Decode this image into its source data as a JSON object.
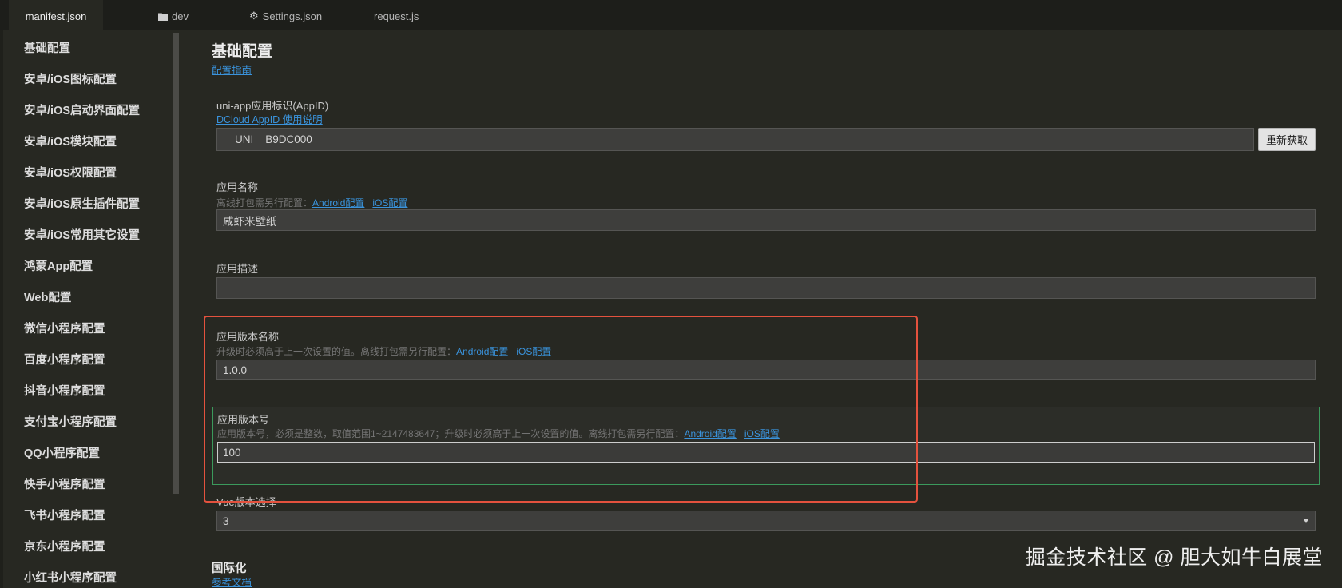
{
  "tabs": [
    {
      "label": "manifest.json"
    },
    {
      "label": "dev",
      "icon": "folder-icon"
    },
    {
      "label": "Settings.json",
      "icon": "gear-icon"
    },
    {
      "label": "request.js"
    }
  ],
  "sidebar": {
    "items": [
      "基础配置",
      "安卓/iOS图标配置",
      "安卓/iOS启动界面配置",
      "安卓/iOS模块配置",
      "安卓/iOS权限配置",
      "安卓/iOS原生插件配置",
      "安卓/iOS常用其它设置",
      "鸿蒙App配置",
      "Web配置",
      "微信小程序配置",
      "百度小程序配置",
      "抖音小程序配置",
      "支付宝小程序配置",
      "QQ小程序配置",
      "快手小程序配置",
      "飞书小程序配置",
      "京东小程序配置",
      "小红书小程序配置"
    ]
  },
  "main": {
    "title": "基础配置",
    "guide_link": "配置指南",
    "appid": {
      "label": "uni-app应用标识(AppID)",
      "help_link": "DCloud AppID 使用说明",
      "value": "__UNI__B9DC000",
      "button": "重新获取"
    },
    "app_name": {
      "label": "应用名称",
      "hint": "离线打包需另行配置：",
      "android_link": "Android配置",
      "ios_link": "iOS配置",
      "value": "咸虾米壁纸"
    },
    "app_description": {
      "label": "应用描述"
    },
    "version_name": {
      "label": "应用版本名称",
      "hint": "升级时必须高于上一次设置的值。离线打包需另行配置：",
      "android_link": "Android配置",
      "ios_link": "iOS配置",
      "value": "1.0.0"
    },
    "version_code": {
      "label": "应用版本号",
      "hint": "应用版本号，必须是整数，取值范围1~2147483647；升级时必须高于上一次设置的值。离线打包需另行配置：",
      "android_link": "Android配置",
      "ios_link": "iOS配置",
      "value": "100"
    },
    "vue_version": {
      "label": "Vue版本选择",
      "value": "3",
      "icon": "chevron-down-icon"
    },
    "i18n": {
      "title": "国际化",
      "doc_link": "参考文档"
    }
  },
  "watermark": "掘金技术社区 @ 胆大如牛白展堂",
  "colors": {
    "background": "#272822",
    "tabbar": "#1d1e1a",
    "link": "#3a93dc",
    "highlight_border": "#e4523e",
    "focused_group_border": "#3b9a5c"
  }
}
